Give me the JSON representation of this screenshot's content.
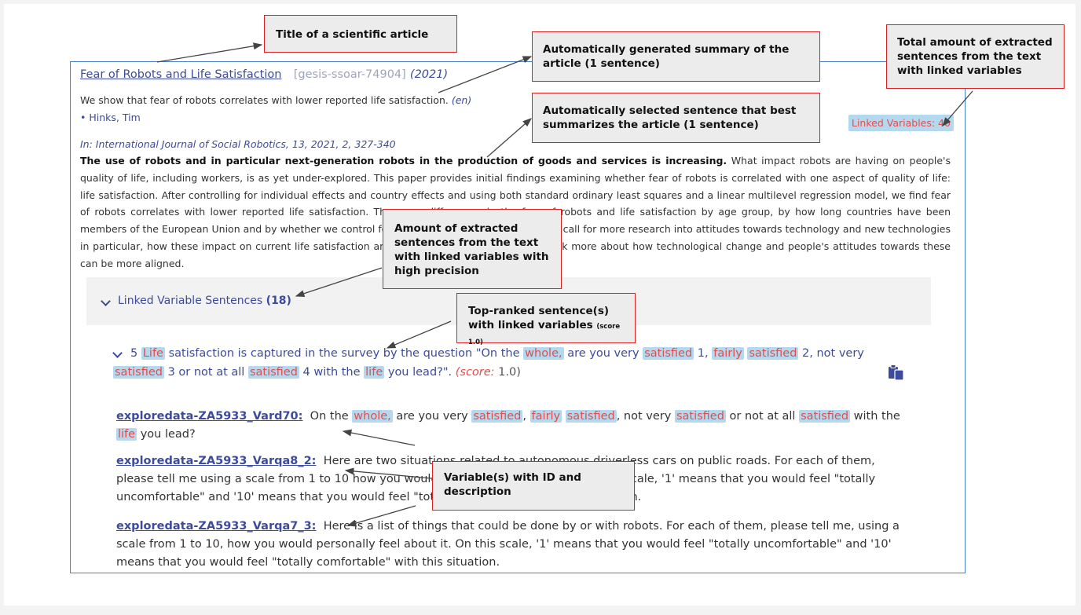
{
  "article": {
    "title": "Fear of Robots and Life Satisfaction",
    "identifier": "[gesis-ssoar-74904]",
    "year": "(2021)",
    "summary": "We show that fear of robots correlates with lower reported life satisfaction.",
    "summary_lang": "(en)",
    "author": "• Hinks, Tim",
    "journal": "In: International Journal of Social Robotics, 13, 2021, 2, 327-340",
    "key_sentence": "The use of robots and in particular next-generation robots in the production of goods and services is increasing.",
    "abstract_rest": "What impact robots are having on people's quality of life, including workers, is as yet under-explored. This paper provides initial findings examining whether fear of robots is correlated with one aspect of quality of life: life satisfaction. After controlling for individual effects and country effects and using both standard ordinary least squares and a linear multilevel regression model, we find fear of robots correlates with lower reported life satisfaction. There are differences in the fear of robots and life satisfaction by age group, by how long countries have been members of the European Union and by whether we control for socio-economic surroundings. We call for more research into attitudes towards technology and new technologies in particular, how these impact on current life satisfaction and broader quality of life and to think more about how technological change and people's attitudes towards these can be more aligned.",
    "linked_variables_badge": "Linked Variables: 40"
  },
  "linked_section": {
    "label": "Linked Variable Sentences",
    "count": "(18)"
  },
  "top_sentence": {
    "num": "5",
    "parts": [
      {
        "t": "Life",
        "h": true
      },
      {
        "t": " satisfaction is captured in the survey by the question \"On the ",
        "h": false
      },
      {
        "t": "whole,",
        "h": true
      },
      {
        "t": " are you very ",
        "h": false
      },
      {
        "t": "satisfied",
        "h": true
      },
      {
        "t": " 1, ",
        "h": false
      },
      {
        "t": "fairly",
        "h": true
      },
      {
        "t": " ",
        "h": false
      },
      {
        "t": "satisfied",
        "h": true
      },
      {
        "t": " 2, not very ",
        "h": false
      },
      {
        "t": "satisfied",
        "h": true
      },
      {
        "t": " 3 or not at all ",
        "h": false
      },
      {
        "t": "satisfied",
        "h": true
      },
      {
        "t": " 4 with the ",
        "h": false
      },
      {
        "t": "life",
        "h": true
      },
      {
        "t": " you lead?\".  ",
        "h": false
      }
    ],
    "score_label": "(score:",
    "score_value": "1.0)"
  },
  "variables": [
    {
      "id": "exploredata-ZA5933_Vard70:",
      "parts": [
        {
          "t": "On the ",
          "h": false
        },
        {
          "t": "whole,",
          "h": true
        },
        {
          "t": " are you very ",
          "h": false
        },
        {
          "t": "satisfied",
          "h": true
        },
        {
          "t": ", ",
          "h": false
        },
        {
          "t": "fairly",
          "h": true
        },
        {
          "t": " ",
          "h": false
        },
        {
          "t": "satisfied",
          "h": true
        },
        {
          "t": ", not very ",
          "h": false
        },
        {
          "t": "satisfied",
          "h": true
        },
        {
          "t": " or not at all ",
          "h": false
        },
        {
          "t": "satisfied",
          "h": true
        },
        {
          "t": " with the ",
          "h": false
        },
        {
          "t": "life",
          "h": true
        },
        {
          "t": " you lead?",
          "h": false
        }
      ]
    },
    {
      "id": "exploredata-ZA5933_Varqa8_2:",
      "parts": [
        {
          "t": "Here are two situations related to autonomous driverless cars on public roads. For each of them, please tell me using a scale from 1 to 10 how you would personally feel about it. On this scale, '1' means that you would feel \"totally uncomfortable\" and '10' means that you would feel \"totally comfortable\" with this situation.",
          "h": false
        }
      ]
    },
    {
      "id": "exploredata-ZA5933_Varqa7_3:",
      "parts": [
        {
          "t": "Here is a list of things that could be done by or with robots. For each of them, please tell me, using a scale from 1 to 10, how you would personally feel about it. On this scale, '1' means that you would feel \"totally uncomfortable\" and '10' means that you would feel \"totally comfortable\" with this situation.",
          "h": false
        }
      ]
    }
  ],
  "callouts": {
    "title": "Title of a scientific article",
    "summary": "Automatically generated summary of the article (1 sentence)",
    "best_sentence": "Automatically selected sentence that best summarizes the article (1 sentence)",
    "total": "Total amount of extracted sentences from the text with linked variables",
    "amount": "Amount of extracted sentences from the text with linked variables with high precision",
    "top_ranked": "Top-ranked sentence(s) with linked variables",
    "top_ranked_small": "(score 1.0)",
    "variables": "Variable(s) with ID and description"
  }
}
